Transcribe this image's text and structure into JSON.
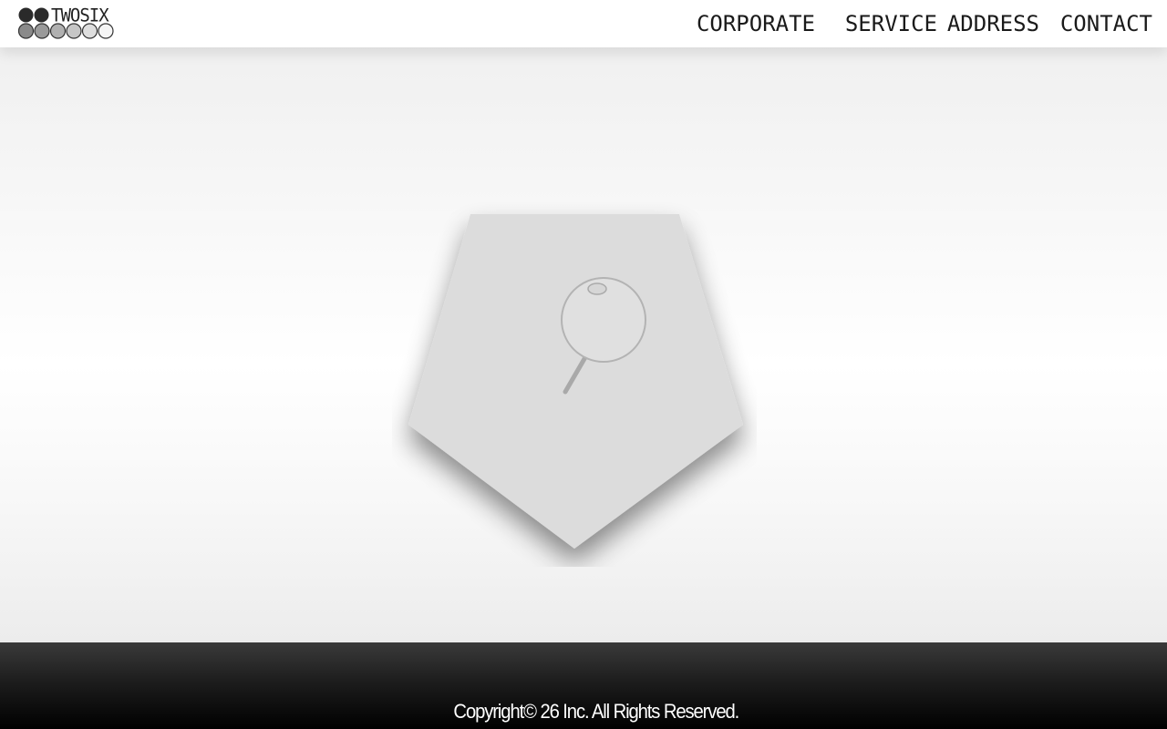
{
  "brand": {
    "name": "TWOSIX",
    "logo_icon": "dots-logo-icon"
  },
  "nav": {
    "items": [
      {
        "label": "CORPORATE"
      },
      {
        "label": "SERVICE"
      },
      {
        "label": "ADDRESS"
      },
      {
        "label": "CONTACT"
      }
    ]
  },
  "hero": {
    "icon": "pushpin-icon",
    "shape": "pentagon"
  },
  "footer": {
    "copyright": "Copyright© 26 Inc. All Rights Reserved."
  },
  "colors": {
    "header_bg": "#ffffff",
    "nav_text": "#1a1a1a",
    "pentagon_fill": "#dcdcdc",
    "footer_bg": "#000000",
    "footer_text": "#ffffff"
  }
}
